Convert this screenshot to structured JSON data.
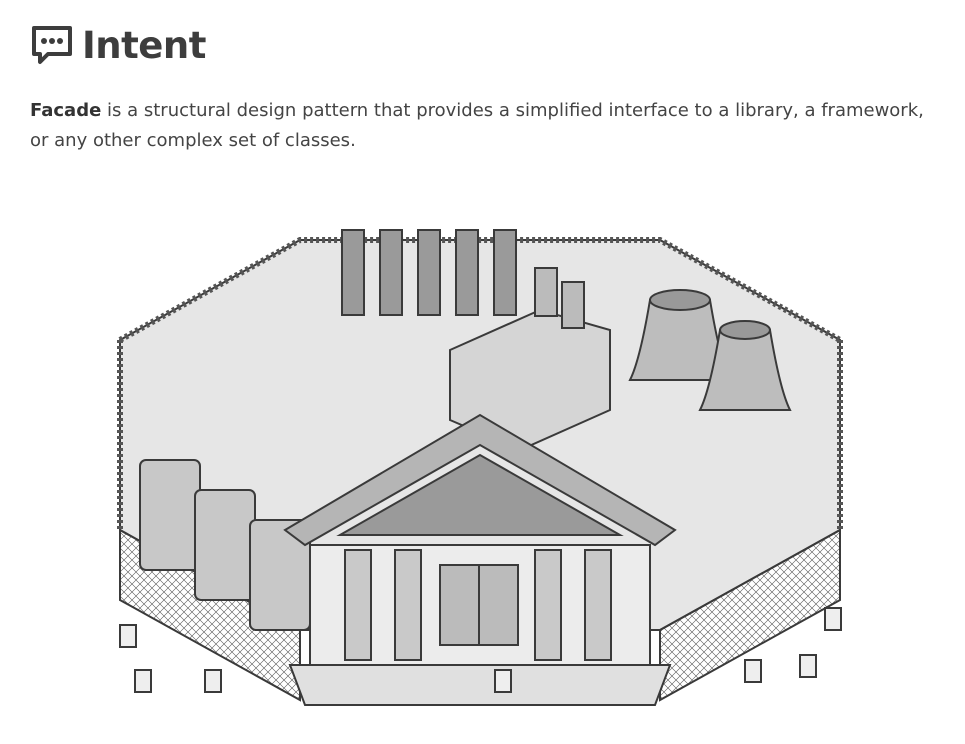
{
  "header": {
    "title": "Intent",
    "icon": "speech-bubble-ellipsis-icon"
  },
  "intro": {
    "term": "Facade",
    "text": " is a structural design pattern that provides a simplified interface to a library, a framework, or any other complex set of classes."
  },
  "illustration": {
    "subject": "facade-building-in-front-of-fenced-factory-complex",
    "palette": {
      "outline": "#3a3a3a",
      "light": "#e8e8e8",
      "mid": "#c9c9c9",
      "dark": "#9a9a9a"
    }
  }
}
